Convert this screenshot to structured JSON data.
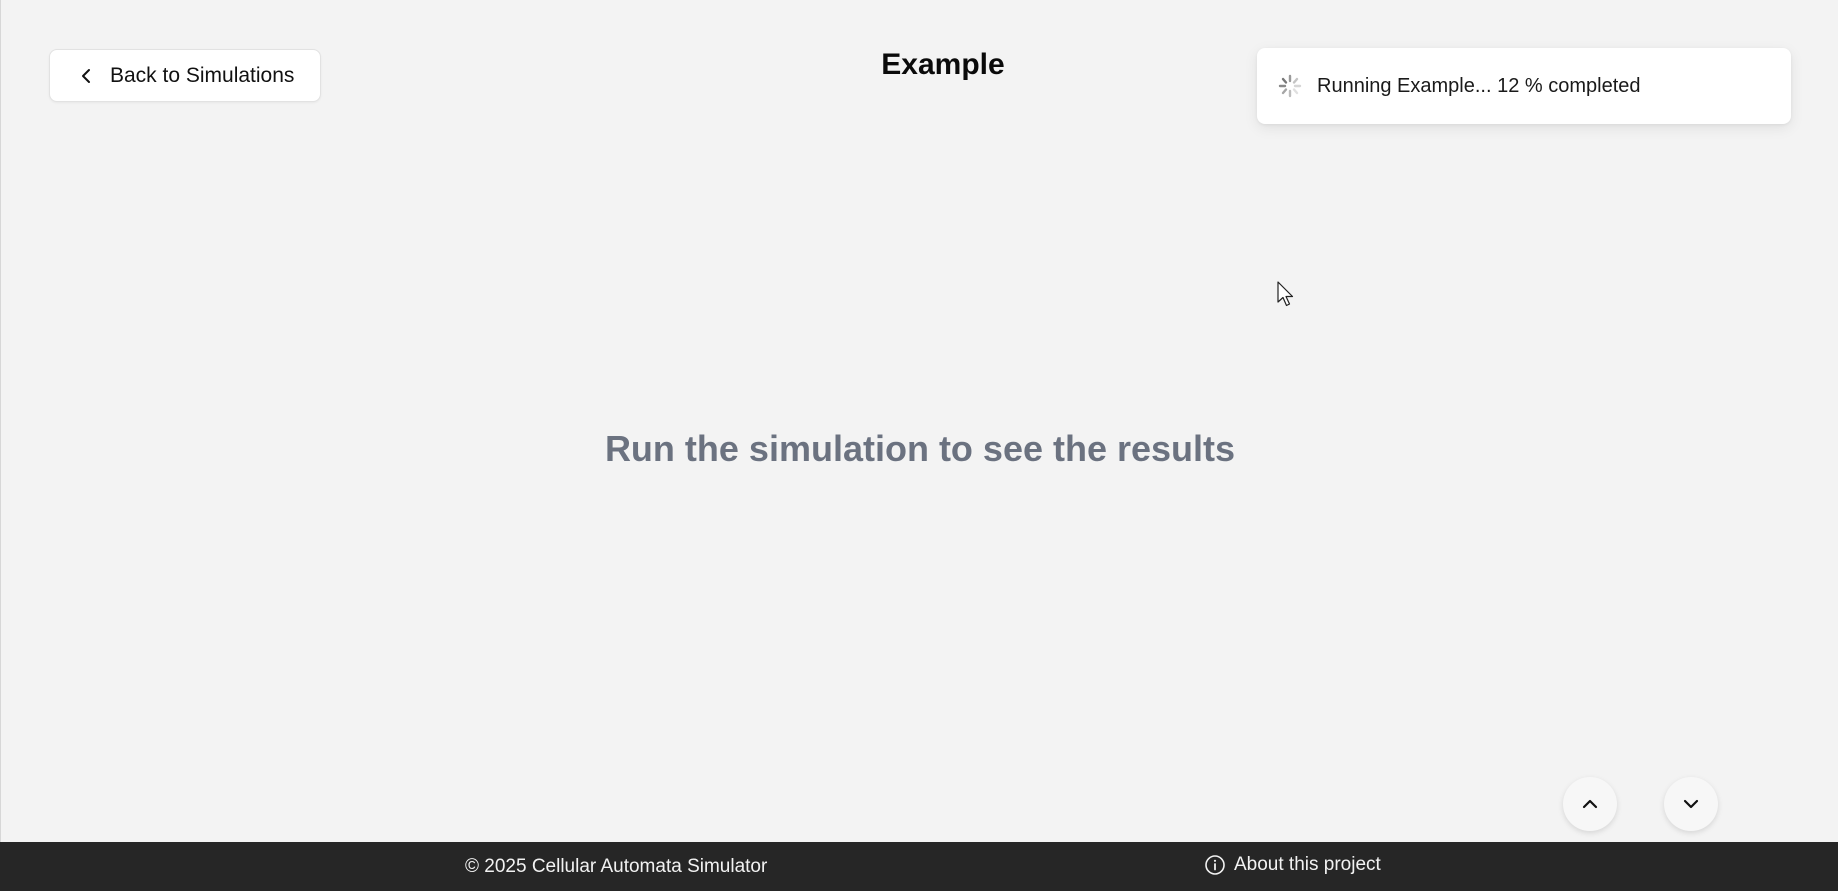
{
  "header": {
    "back_label": "Back to Simulations",
    "title": "Example"
  },
  "toast": {
    "message": "Running Example... 12 % completed",
    "progress_percent": 12
  },
  "main": {
    "empty_message": "Run the simulation to see the results"
  },
  "footer": {
    "copyright": "© 2025 Cellular Automata Simulator",
    "about_label": "About this project"
  },
  "icons": {
    "back": "chevron-left-icon",
    "spinner": "spinner-icon",
    "scroll_up": "chevron-up-icon",
    "scroll_down": "chevron-down-icon",
    "about": "info-icon"
  },
  "colors": {
    "background": "#f3f3f3",
    "footer_background": "#262626",
    "empty_message": "#6b7280"
  }
}
